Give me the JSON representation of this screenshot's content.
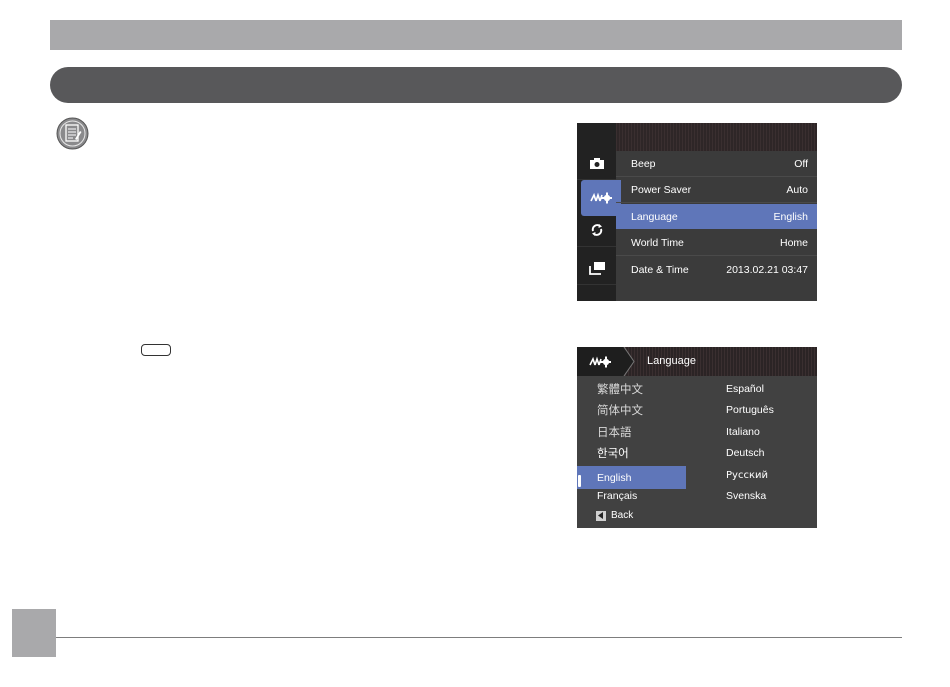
{
  "page": {
    "icons": {
      "note": "note-icon",
      "key": "button-key-icon"
    }
  },
  "screen_settings": {
    "tabs": [
      "camera-icon",
      "settings-icon",
      "refresh-icon",
      "playback-icon"
    ],
    "active_tab": 1,
    "rows": [
      {
        "label": "Beep",
        "value": "Off"
      },
      {
        "label": "Power Saver",
        "value": "Auto"
      },
      {
        "label": "Language",
        "value": "English",
        "selected": true
      },
      {
        "label": "World Time",
        "value": "Home"
      },
      {
        "label": "Date & Time",
        "value": "2013.02.21 03:47"
      }
    ],
    "accent_color": "#5f76b9"
  },
  "screen_language": {
    "title": "Language",
    "left_column": [
      "繁體中文",
      "简体中文",
      "日本語",
      "한국어",
      "English",
      "Français"
    ],
    "right_column": [
      "Español",
      "Português",
      "Italiano",
      "Deutsch",
      "Русский",
      "Svenska"
    ],
    "selected": "English",
    "back_label": "Back"
  }
}
